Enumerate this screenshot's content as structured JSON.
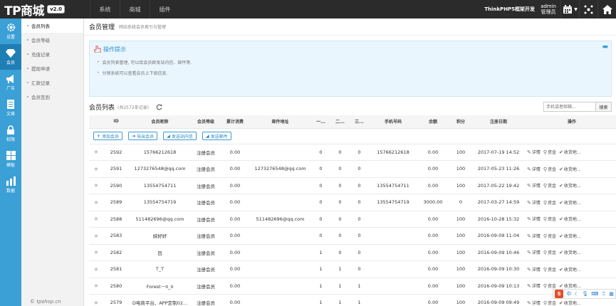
{
  "topbar": {
    "brand": "TP商城",
    "version": "v2.0",
    "nav": [
      "系统",
      "商城",
      "插件"
    ],
    "site_name": "ThinkPHP5框架开发",
    "user_name": "admin",
    "user_role": "管理员"
  },
  "sidebar": {
    "items": [
      {
        "label": "设置",
        "icon": "gear-icon"
      },
      {
        "label": "会员",
        "icon": "diamond-icon",
        "active": true
      },
      {
        "label": "广告",
        "icon": "megaphone-icon"
      },
      {
        "label": "文章",
        "icon": "document-icon"
      },
      {
        "label": "权限",
        "icon": "lock-icon"
      },
      {
        "label": "模板",
        "icon": "grid-icon"
      },
      {
        "label": "数据",
        "icon": "database-icon"
      }
    ]
  },
  "subsidebar": {
    "items": [
      "会员列表",
      "会员等级",
      "充值记录",
      "提现申请",
      "汇款记录",
      "会员签到"
    ],
    "active_index": 0,
    "copyright": "© tpshop.cn"
  },
  "page": {
    "title": "会员管理",
    "description": "网站系统会员索引与管理"
  },
  "tips": {
    "title": "操作提示",
    "items": [
      "会员列表管理, 可以给会员群发站内信、邮件等.",
      "分销系统可以查看会员上下级信息."
    ]
  },
  "list": {
    "title": "会员列表",
    "count": "(共2572条记录)",
    "search_placeholder": "手机或者邮箱...",
    "search_button": "搜索"
  },
  "table": {
    "headers": [
      "",
      "ID",
      "会员昵称",
      "会员等级",
      "累计消费",
      "邮件地址",
      "一...",
      "二...",
      "三...",
      "手机号码",
      "余额",
      "积分",
      "注册日期",
      "操作"
    ],
    "actions": [
      "添加会员",
      "导出会员",
      "发送站内信",
      "发送邮件"
    ],
    "row_ops": [
      "详情",
      "资金",
      "收货地..."
    ],
    "rows": [
      [
        "2592",
        "15766212618",
        "注册会员",
        "0.00",
        "",
        "0",
        "0",
        "0",
        "15766212618",
        "0.00",
        "100",
        "2017-07-19 14:52"
      ],
      [
        "2591",
        "1273276548@qq.com",
        "注册会员",
        "0.00",
        "1273276548@qq.com",
        "0",
        "0",
        "0",
        "",
        "0.00",
        "100",
        "2017-05-23 11:26"
      ],
      [
        "2590",
        "13554754711",
        "注册会员",
        "0.00",
        "",
        "0",
        "0",
        "0",
        "13554754711",
        "0.00",
        "100",
        "2017-05-22 19:42"
      ],
      [
        "2589",
        "13554754719",
        "注册会员",
        "0.00",
        "",
        "0",
        "0",
        "0",
        "13554754719",
        "3000.00",
        "0",
        "2017-03-27 14:59"
      ],
      [
        "2588",
        "511482696@qq.com",
        "注册会员",
        "0.00",
        "511482696@qq.com",
        "0",
        "0",
        "0",
        "",
        "0.00",
        "100",
        "2016-10-28 15:32"
      ],
      [
        "2583",
        "妹好好",
        "注册会员",
        "0.00",
        "",
        "0",
        "0",
        "0",
        "",
        "0.00",
        "100",
        "2016-09-09 11:04"
      ],
      [
        "2582",
        "目",
        "注册会员",
        "0.00",
        "",
        "1",
        "0",
        "0",
        "",
        "0.00",
        "100",
        "2016-09-09 10:46"
      ],
      [
        "2581",
        "T_T",
        "注册会员",
        "0.00",
        "",
        "1",
        "1",
        "0",
        "",
        "0.00",
        "100",
        "2016-09-09 10:30"
      ],
      [
        "2580",
        "Forest－π_π",
        "注册会员",
        "0.00",
        "",
        "1",
        "1",
        "1",
        "",
        "0.00",
        "100",
        "2016-09-09 10:13"
      ],
      [
        "2579",
        "D电商平台、APP定制02...",
        "注册会员",
        "0.00",
        "",
        "1",
        "1",
        "1",
        "",
        "0.00",
        "100",
        "2016-09-09 09:49"
      ]
    ]
  },
  "ime": {
    "logo": "S",
    "lang": "中"
  }
}
